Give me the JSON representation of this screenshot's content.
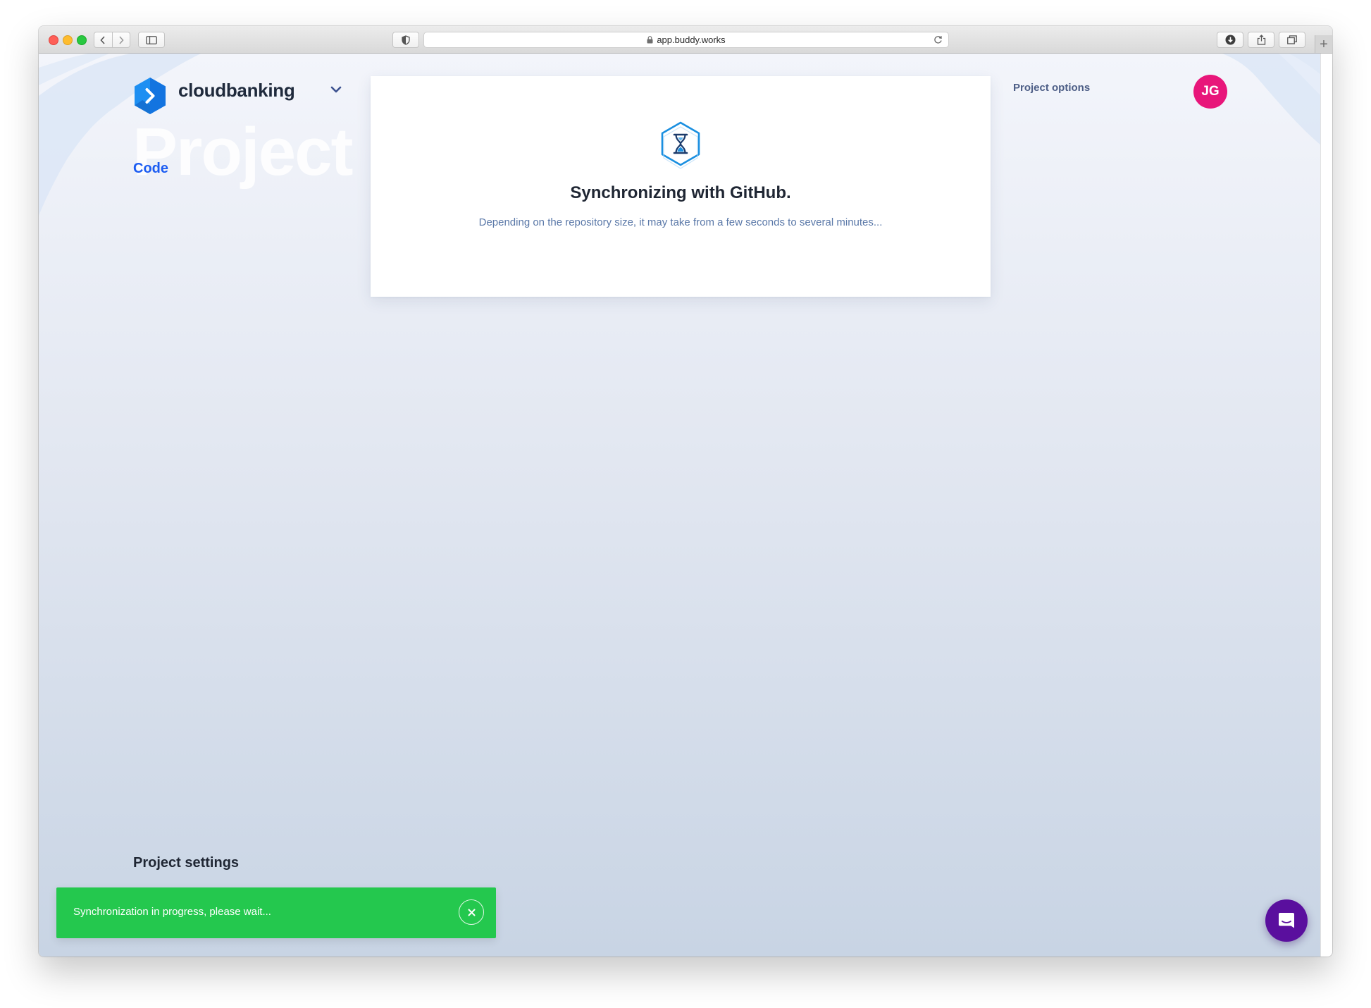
{
  "browser": {
    "url": "app.buddy.works",
    "new_tab_label": "+"
  },
  "header": {
    "project_name": "cloudbanking",
    "background_heading": "Project",
    "section_label": "Code",
    "project_options_label": "Project options",
    "avatar_initials": "JG"
  },
  "sync_card": {
    "title": "Synchronizing with GitHub.",
    "description": "Depending on the repository size, it may take from a few seconds to several minutes..."
  },
  "sidebar": {
    "settings_heading": "Project settings"
  },
  "toast": {
    "message": "Synchronization in progress, please wait...",
    "close_symbol": "×"
  },
  "colors": {
    "accent_blue": "#1b5cf2",
    "avatar_pink": "#e8167a",
    "toast_green": "#24c84e",
    "chat_purple": "#5a0f9e"
  },
  "icons": {
    "logo": "buddy-hexagon-logo-icon",
    "sync": "hourglass-hexagon-icon",
    "chat": "chat-bubble-icon"
  }
}
